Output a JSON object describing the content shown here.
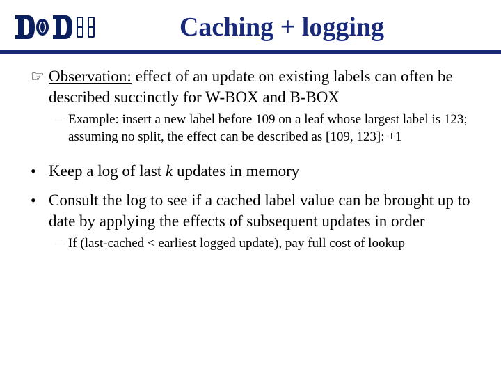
{
  "header": {
    "title": "Caching + logging"
  },
  "bullets": [
    {
      "icon": "finger",
      "prefix_underline": "Observation:",
      "rest": " effect of an update on existing labels can often be described succinctly for W-BOX and B-BOX",
      "sub": "Example: insert a new label before 109 on a leaf whose largest label is 123; assuming no split, the effect can be described as [109, 123]: +1"
    },
    {
      "icon": "dot",
      "text_a": "Keep a log of last ",
      "italic": "k",
      "text_b": " updates in memory"
    },
    {
      "icon": "dot",
      "text": "Consult the log to see if a cached label value can be brought up to date by applying the effects of subsequent updates in order",
      "sub": "If (last-cached < earliest logged update), pay full cost of lookup"
    }
  ]
}
